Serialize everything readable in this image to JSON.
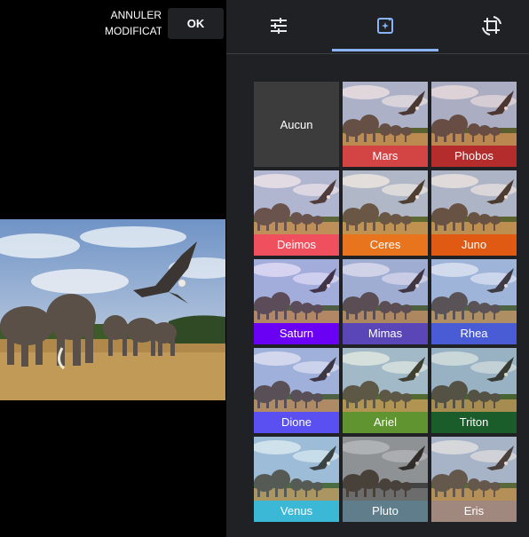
{
  "header": {
    "cancel_line1": "ANNULER",
    "cancel_line2": "MODIFICATIONS",
    "ok_label": "OK"
  },
  "tabs": [
    {
      "icon": "sliders-icon",
      "active": false
    },
    {
      "icon": "auto-filter-icon",
      "active": true
    },
    {
      "icon": "crop-rotate-icon",
      "active": false
    }
  ],
  "filters": {
    "none_label": "Aucun",
    "items": [
      {
        "label": "Mars",
        "color": "#d34545"
      },
      {
        "label": "Phobos",
        "color": "#b52c2c"
      },
      {
        "label": "Deimos",
        "color": "#f0505e"
      },
      {
        "label": "Ceres",
        "color": "#e8741e"
      },
      {
        "label": "Juno",
        "color": "#e05a14"
      },
      {
        "label": "Saturn",
        "color": "#6a00f4"
      },
      {
        "label": "Mimas",
        "color": "#5b46b8"
      },
      {
        "label": "Rhea",
        "color": "#4a5bd6"
      },
      {
        "label": "Dione",
        "color": "#5a4ff0"
      },
      {
        "label": "Ariel",
        "color": "#5f9430"
      },
      {
        "label": "Triton",
        "color": "#1a5c2a"
      },
      {
        "label": "Venus",
        "color": "#3ab8d6"
      },
      {
        "label": "Pluto",
        "color": "#607d8b"
      },
      {
        "label": "Eris",
        "color": "#a1887f"
      }
    ]
  },
  "colors": {
    "panel_bg": "#202124",
    "accent": "#8ab4f8"
  }
}
